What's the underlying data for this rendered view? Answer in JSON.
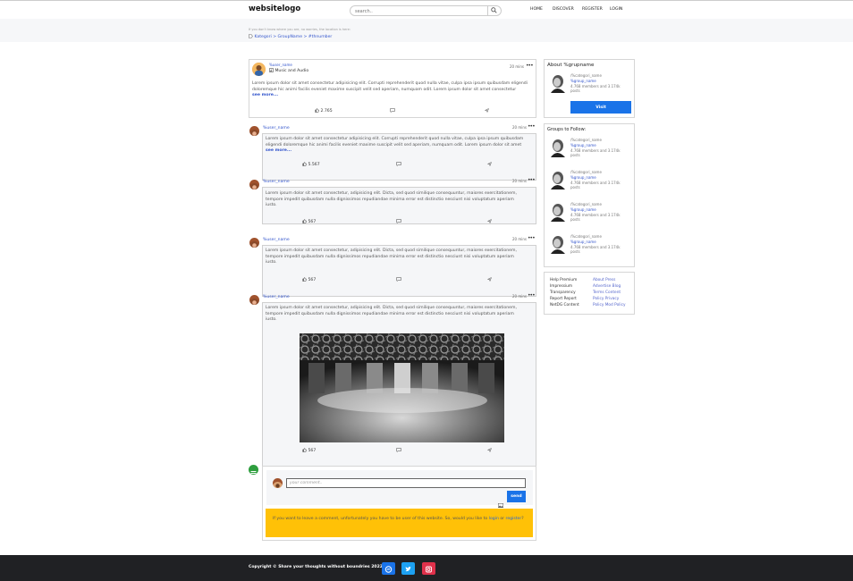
{
  "nav": {
    "logo": "websitelogo",
    "search_placeholder": "search..",
    "menu": [
      "HOME",
      "DISCOVER",
      "REGISTER",
      "LOGIN"
    ]
  },
  "breadcrumb": {
    "info": "If you don't know where you are, no worries, the location is here:",
    "path": "Kategori > GroupName > #thnumber"
  },
  "main_post": {
    "user": "%user_name",
    "group": "Music and Audio",
    "time": "20 mins",
    "text": "Lorem ipsum dolor sit amet consectetur adipisicing elit. Corrupti reprehenderit quod nulla vitae, culpa ipsa ipsum quibusdam eligendi doloremque hic animi facilis eveniet maxime suscipit velit sed aperiam, numquam odit. Lorem ipsum dolor sit amet consectetur",
    "see_more": "see more...",
    "likes": "2.765"
  },
  "replies": [
    {
      "user": "%user_name",
      "time": "20 mins",
      "text": "Lorem ipsum dolor sit amet consectetur adipisicing elit. Corrupti reprehenderit quod nulla vitae, culpa ipsa ipsum quibusdam eligendi doloremque hic animi facilis eveniet maxime suscipit velit sed aperiam, numquam odit. Lorem ipsum dolor sit amet",
      "see_more": "see more...",
      "likes": "5.567"
    },
    {
      "user": "%user_name",
      "time": "20 mins",
      "text": "Lorem ipsum dolor sit amet consectetur, adipisicing elit. Dicta, sed quod similique consequuntur, maiores exercitationem, tempore impedit quibusdam nulla dignissimos repudiandae minima error est distinctio nesciunt nisi voluptatum aperiam iusto.",
      "likes": "567"
    },
    {
      "user": "%user_name",
      "time": "20 mins",
      "text": "Lorem ipsum dolor sit amet consectetur, adipisicing elit. Dicta, sed quod similique consequuntur, maiores exercitationem, tempore impedit quibusdam nulla dignissimos repudiandae minima error est distinctio nesciunt nisi voluptatum aperiam iusto.",
      "likes": "567"
    },
    {
      "user": "%user_name",
      "time": "20 mins",
      "text": "Lorem ipsum dolor sit amet consectetur, adipisicing elit. Dicta, sed quod similique consequuntur, maiores exercitationem, tempore impedit quibusdam nulla dignissimos repudiandae minima error est distinctio nesciunt nisi voluptatum aperiam iusto.",
      "likes": "567"
    }
  ],
  "comment": {
    "placeholder": "your comment..",
    "send": "send",
    "notice_pre": "If you want to leave a comment, unfortunately you have to be user of this website. So, would you like to",
    "login": "login",
    "or": "or",
    "register": "register",
    "notice_post": "?"
  },
  "sidebar": {
    "about_title": "About %grupname",
    "about": {
      "category": "/%categori_name",
      "group": "%group_name",
      "stats": "4.768 members and 3.174k",
      "posts": "posts"
    },
    "visit": "Visit",
    "follow_title": "Groups to Follow:",
    "groups": [
      {
        "category": "/%categori_name",
        "group": "%group_name",
        "stats": "4.768 members and 3.174k",
        "posts": "posts"
      },
      {
        "category": "/%categori_name",
        "group": "%group_name",
        "stats": "4.768 members and 3.174k",
        "posts": "posts"
      },
      {
        "category": "/%categori_name",
        "group": "%group_name",
        "stats": "4.768 members and 3.174k",
        "posts": "posts"
      },
      {
        "category": "/%categori_name",
        "group": "%group_name",
        "stats": "4.768 members and 3.174k",
        "posts": "posts"
      }
    ],
    "links_left": [
      "Help Premium",
      "Impressium",
      "Transparency",
      "Report Report",
      "NetDG Content"
    ],
    "links_right": [
      "About Press",
      "Advertise Blog",
      "Terms Content",
      "Policy Privacy",
      "Policy Mod Policy"
    ]
  },
  "footer": {
    "copyright": "Copyright © Share your thoughts without boundries 2022."
  },
  "colors": {
    "accent": "#1a73e8",
    "notice": "#ffc107",
    "footer": "#202124",
    "link": "#3355cc"
  }
}
